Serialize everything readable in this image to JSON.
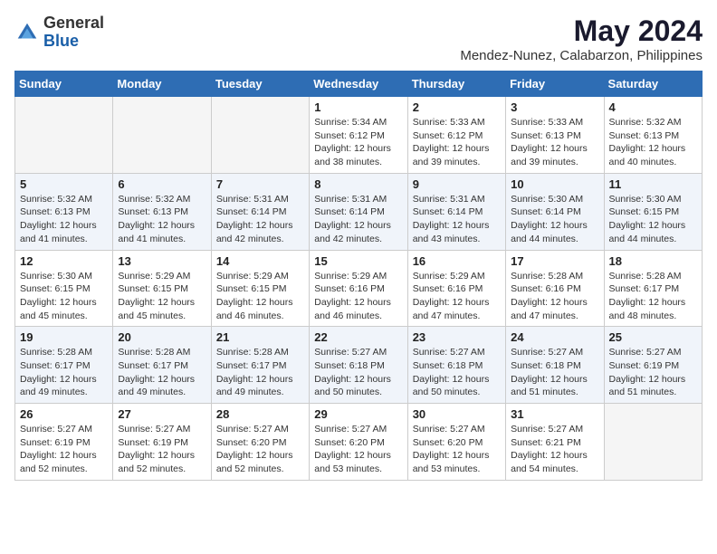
{
  "logo": {
    "general": "General",
    "blue": "Blue"
  },
  "title": "May 2024",
  "subtitle": "Mendez-Nunez, Calabarzon, Philippines",
  "days_of_week": [
    "Sunday",
    "Monday",
    "Tuesday",
    "Wednesday",
    "Thursday",
    "Friday",
    "Saturday"
  ],
  "weeks": [
    {
      "days": [
        {
          "num": "",
          "info": "",
          "empty": true
        },
        {
          "num": "",
          "info": "",
          "empty": true
        },
        {
          "num": "",
          "info": "",
          "empty": true
        },
        {
          "num": "1",
          "info": "Sunrise: 5:34 AM\nSunset: 6:12 PM\nDaylight: 12 hours\nand 38 minutes.",
          "empty": false
        },
        {
          "num": "2",
          "info": "Sunrise: 5:33 AM\nSunset: 6:12 PM\nDaylight: 12 hours\nand 39 minutes.",
          "empty": false
        },
        {
          "num": "3",
          "info": "Sunrise: 5:33 AM\nSunset: 6:13 PM\nDaylight: 12 hours\nand 39 minutes.",
          "empty": false
        },
        {
          "num": "4",
          "info": "Sunrise: 5:32 AM\nSunset: 6:13 PM\nDaylight: 12 hours\nand 40 minutes.",
          "empty": false
        }
      ]
    },
    {
      "days": [
        {
          "num": "5",
          "info": "Sunrise: 5:32 AM\nSunset: 6:13 PM\nDaylight: 12 hours\nand 41 minutes.",
          "empty": false
        },
        {
          "num": "6",
          "info": "Sunrise: 5:32 AM\nSunset: 6:13 PM\nDaylight: 12 hours\nand 41 minutes.",
          "empty": false
        },
        {
          "num": "7",
          "info": "Sunrise: 5:31 AM\nSunset: 6:14 PM\nDaylight: 12 hours\nand 42 minutes.",
          "empty": false
        },
        {
          "num": "8",
          "info": "Sunrise: 5:31 AM\nSunset: 6:14 PM\nDaylight: 12 hours\nand 42 minutes.",
          "empty": false
        },
        {
          "num": "9",
          "info": "Sunrise: 5:31 AM\nSunset: 6:14 PM\nDaylight: 12 hours\nand 43 minutes.",
          "empty": false
        },
        {
          "num": "10",
          "info": "Sunrise: 5:30 AM\nSunset: 6:14 PM\nDaylight: 12 hours\nand 44 minutes.",
          "empty": false
        },
        {
          "num": "11",
          "info": "Sunrise: 5:30 AM\nSunset: 6:15 PM\nDaylight: 12 hours\nand 44 minutes.",
          "empty": false
        }
      ]
    },
    {
      "days": [
        {
          "num": "12",
          "info": "Sunrise: 5:30 AM\nSunset: 6:15 PM\nDaylight: 12 hours\nand 45 minutes.",
          "empty": false
        },
        {
          "num": "13",
          "info": "Sunrise: 5:29 AM\nSunset: 6:15 PM\nDaylight: 12 hours\nand 45 minutes.",
          "empty": false
        },
        {
          "num": "14",
          "info": "Sunrise: 5:29 AM\nSunset: 6:15 PM\nDaylight: 12 hours\nand 46 minutes.",
          "empty": false
        },
        {
          "num": "15",
          "info": "Sunrise: 5:29 AM\nSunset: 6:16 PM\nDaylight: 12 hours\nand 46 minutes.",
          "empty": false
        },
        {
          "num": "16",
          "info": "Sunrise: 5:29 AM\nSunset: 6:16 PM\nDaylight: 12 hours\nand 47 minutes.",
          "empty": false
        },
        {
          "num": "17",
          "info": "Sunrise: 5:28 AM\nSunset: 6:16 PM\nDaylight: 12 hours\nand 47 minutes.",
          "empty": false
        },
        {
          "num": "18",
          "info": "Sunrise: 5:28 AM\nSunset: 6:17 PM\nDaylight: 12 hours\nand 48 minutes.",
          "empty": false
        }
      ]
    },
    {
      "days": [
        {
          "num": "19",
          "info": "Sunrise: 5:28 AM\nSunset: 6:17 PM\nDaylight: 12 hours\nand 49 minutes.",
          "empty": false
        },
        {
          "num": "20",
          "info": "Sunrise: 5:28 AM\nSunset: 6:17 PM\nDaylight: 12 hours\nand 49 minutes.",
          "empty": false
        },
        {
          "num": "21",
          "info": "Sunrise: 5:28 AM\nSunset: 6:17 PM\nDaylight: 12 hours\nand 49 minutes.",
          "empty": false
        },
        {
          "num": "22",
          "info": "Sunrise: 5:27 AM\nSunset: 6:18 PM\nDaylight: 12 hours\nand 50 minutes.",
          "empty": false
        },
        {
          "num": "23",
          "info": "Sunrise: 5:27 AM\nSunset: 6:18 PM\nDaylight: 12 hours\nand 50 minutes.",
          "empty": false
        },
        {
          "num": "24",
          "info": "Sunrise: 5:27 AM\nSunset: 6:18 PM\nDaylight: 12 hours\nand 51 minutes.",
          "empty": false
        },
        {
          "num": "25",
          "info": "Sunrise: 5:27 AM\nSunset: 6:19 PM\nDaylight: 12 hours\nand 51 minutes.",
          "empty": false
        }
      ]
    },
    {
      "days": [
        {
          "num": "26",
          "info": "Sunrise: 5:27 AM\nSunset: 6:19 PM\nDaylight: 12 hours\nand 52 minutes.",
          "empty": false
        },
        {
          "num": "27",
          "info": "Sunrise: 5:27 AM\nSunset: 6:19 PM\nDaylight: 12 hours\nand 52 minutes.",
          "empty": false
        },
        {
          "num": "28",
          "info": "Sunrise: 5:27 AM\nSunset: 6:20 PM\nDaylight: 12 hours\nand 52 minutes.",
          "empty": false
        },
        {
          "num": "29",
          "info": "Sunrise: 5:27 AM\nSunset: 6:20 PM\nDaylight: 12 hours\nand 53 minutes.",
          "empty": false
        },
        {
          "num": "30",
          "info": "Sunrise: 5:27 AM\nSunset: 6:20 PM\nDaylight: 12 hours\nand 53 minutes.",
          "empty": false
        },
        {
          "num": "31",
          "info": "Sunrise: 5:27 AM\nSunset: 6:21 PM\nDaylight: 12 hours\nand 54 minutes.",
          "empty": false
        },
        {
          "num": "",
          "info": "",
          "empty": true
        }
      ]
    }
  ]
}
